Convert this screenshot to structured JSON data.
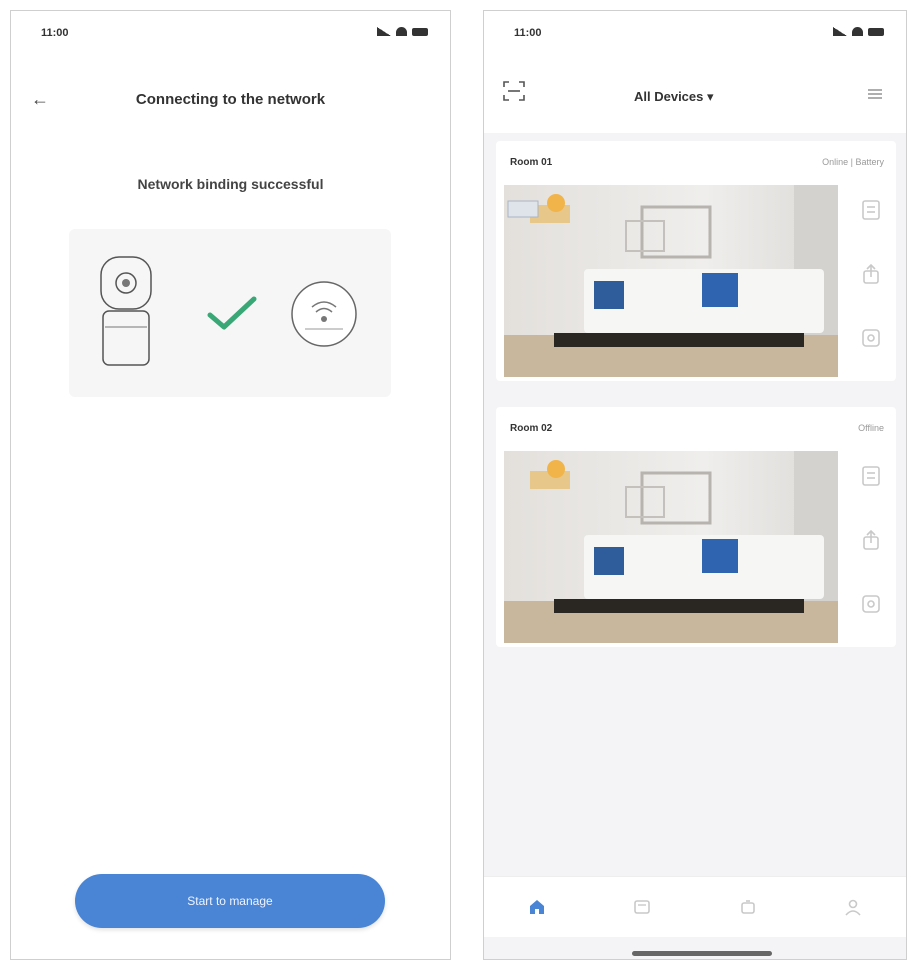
{
  "left": {
    "status_time": "11:00",
    "title": "Connecting to the network",
    "success_message": "Network binding successful",
    "primary_button": "Start to manage"
  },
  "right": {
    "status_time": "11:00",
    "home_title": "All Devices ▾",
    "devices": [
      {
        "name": "Room 01",
        "status": "Online | Battery"
      },
      {
        "name": "Room 02",
        "status": "Offline"
      }
    ],
    "tabs": [
      {
        "name": "home-icon",
        "active": true
      },
      {
        "name": "message-icon",
        "active": false
      },
      {
        "name": "cloud-icon",
        "active": false
      },
      {
        "name": "profile-icon",
        "active": false
      }
    ]
  },
  "colors": {
    "accent": "#4a84d4",
    "check": "#3aa776",
    "icon_muted": "#c9c9c9"
  }
}
